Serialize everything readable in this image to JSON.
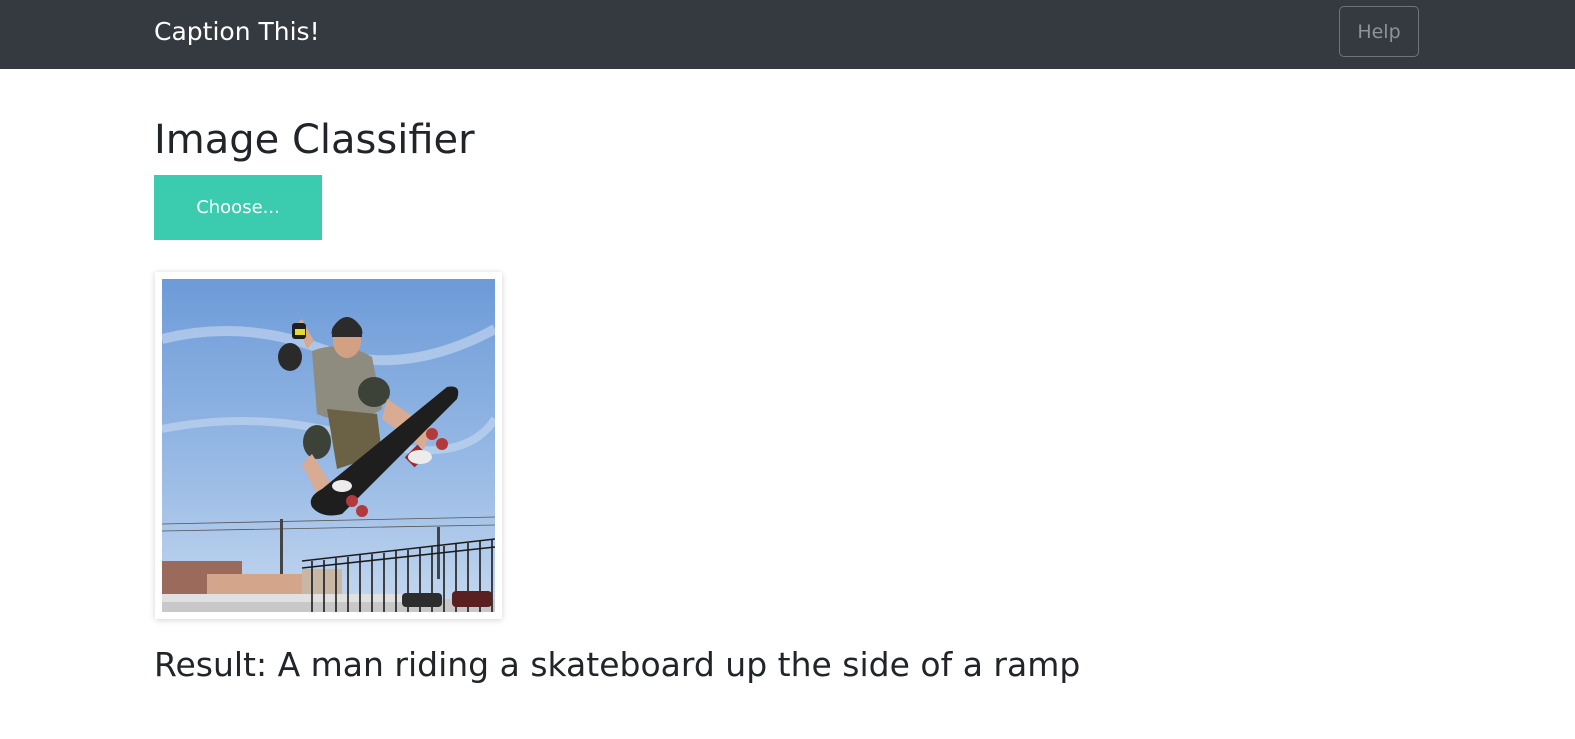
{
  "navbar": {
    "brand": "Caption This!",
    "help_label": "Help",
    "background": "#343a40"
  },
  "main": {
    "title": "Image Classifier",
    "choose_label": "Choose...",
    "choose_color": "#3bccb0",
    "result_text": "Result: A man riding a skateboard up the side of a ramp"
  }
}
